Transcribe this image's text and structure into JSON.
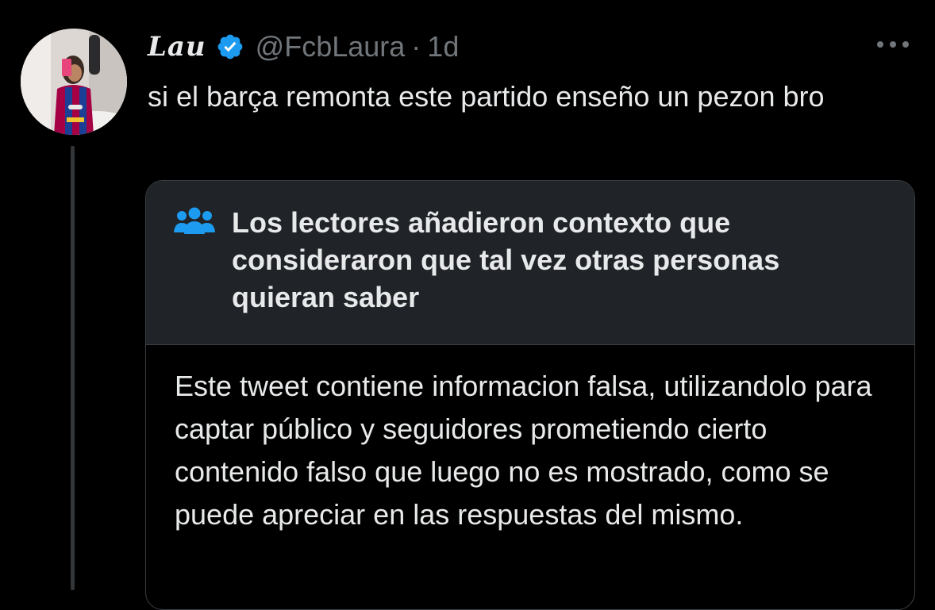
{
  "tweet": {
    "display_name": "Lau",
    "handle": "@FcbLaura",
    "separator": "·",
    "time": "1d",
    "text": "si el barça remonta este partido enseño un pezon bro"
  },
  "community_note": {
    "title": "Los lectores añadieron contexto que consideraron que tal vez otras personas quieran saber",
    "body": "Este tweet contiene informacion falsa, utilizandolo para captar público y seguidores prometiendo cierto contenido falso que luego no es mostrado, como se puede apreciar en las respuestas del mismo."
  },
  "icons": {
    "verified": "verified-badge-icon",
    "more": "more-options-icon",
    "note": "community-people-icon"
  },
  "colors": {
    "background": "#000000",
    "text_primary": "#e7e9ea",
    "text_secondary": "#71767b",
    "verified_blue": "#1d9bf0",
    "note_header_bg": "#202327",
    "note_border": "#3a3d41"
  }
}
